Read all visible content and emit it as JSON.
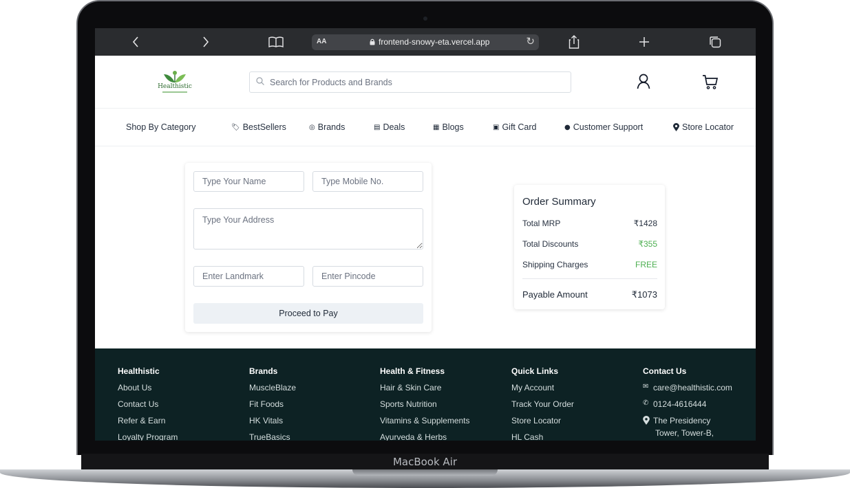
{
  "device": {
    "label": "MacBook Air"
  },
  "browser": {
    "text_size_label": "AA",
    "url": "frontend-snowy-eta.vercel.app"
  },
  "header": {
    "logo_text": "Healthistic",
    "search_placeholder": "Search for Products and Brands"
  },
  "nav": {
    "shop_by_category": "Shop By Category",
    "items": [
      {
        "label": "BestSellers",
        "icon": "tag-icon"
      },
      {
        "label": "Brands",
        "icon": "badge-icon"
      },
      {
        "label": "Deals",
        "icon": "ticket-icon"
      },
      {
        "label": "Blogs",
        "icon": "newspaper-icon"
      },
      {
        "label": "Gift Card",
        "icon": "gift-icon"
      },
      {
        "label": "Customer Support",
        "icon": "chat-icon"
      },
      {
        "label": "Store Locator",
        "icon": "location-pin-icon"
      }
    ]
  },
  "form": {
    "name_placeholder": "Type Your Name",
    "mobile_placeholder": "Type Mobile No.",
    "address_placeholder": "Type Your Address",
    "landmark_placeholder": "Enter Landmark",
    "pincode_placeholder": "Enter Pincode",
    "submit_label": "Proceed to Pay"
  },
  "summary": {
    "title": "Order Summary",
    "rows": [
      {
        "label": "Total MRP",
        "value": "₹1428"
      },
      {
        "label": "Total Discounts",
        "value": "₹355"
      },
      {
        "label": "Shipping Charges",
        "value": "FREE"
      }
    ],
    "payable_label": "Payable Amount",
    "payable_value": "₹1073",
    "accent_green": "#4caf50"
  },
  "footer": {
    "columns": [
      {
        "heading": "Healthistic",
        "links": [
          "About Us",
          "Contact Us",
          "Refer & Earn",
          "Loyalty Program"
        ]
      },
      {
        "heading": "Brands",
        "links": [
          "MuscleBlaze",
          "Fit Foods",
          "HK Vitals",
          "TrueBasics"
        ]
      },
      {
        "heading": "Health & Fitness",
        "links": [
          "Hair & Skin Care",
          "Sports Nutrition",
          "Vitamins & Supplements",
          "Ayurveda & Herbs"
        ]
      },
      {
        "heading": "Quick Links",
        "links": [
          "My Account",
          "Track Your Order",
          "Store Locator",
          "HL Cash"
        ]
      }
    ],
    "contact": {
      "heading": "Contact Us",
      "email": "care@healthistic.com",
      "phone": "0124-4616444",
      "address_line1": "The Presidency",
      "address_line2": "Tower, Tower-B,"
    },
    "background": "#0d2224"
  }
}
